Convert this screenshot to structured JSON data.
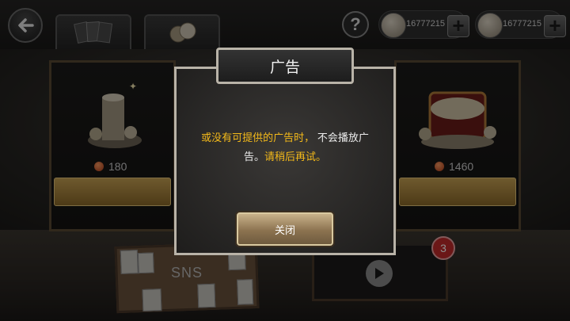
{
  "currency": {
    "primary_amount": "16777215",
    "secondary_amount": "16777215"
  },
  "help": {
    "label": "?"
  },
  "shop": {
    "left_item": {
      "price": "180"
    },
    "right_item": {
      "price": "1460"
    }
  },
  "sns": {
    "label": "SNS"
  },
  "video": {
    "badge_count": "3"
  },
  "dialog": {
    "title": "广告",
    "message_part1": "或没有可提供的广告时，",
    "message_part2": "不会播放广",
    "message_part3": "告。",
    "message_part4": "请稍后再试。",
    "close_label": "关闭"
  },
  "icons": [
    "back-arrow-icon",
    "cards-icon",
    "coins-icon",
    "help-icon",
    "coin-icon",
    "plus-icon",
    "play-icon"
  ],
  "colors": {
    "highlight_text": "#f3b91a",
    "dialog_border": "#b9b3a8",
    "badge": "#c42a2a",
    "gold_button": "#c8b18a"
  }
}
